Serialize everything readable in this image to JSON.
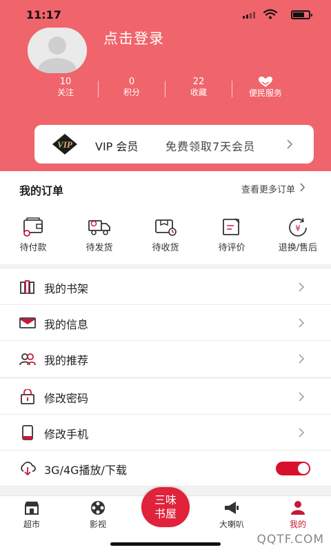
{
  "status_bar": {
    "time": "11:17"
  },
  "profile": {
    "login_label": "点击登录"
  },
  "stats": [
    {
      "value": "10",
      "label": "关注"
    },
    {
      "value": "0",
      "label": "积分"
    },
    {
      "value": "22",
      "label": "收藏"
    }
  ],
  "service": {
    "label": "便民服务"
  },
  "vip": {
    "logo_text": "VIP",
    "title": "VIP 会员",
    "promo": "免费领取7天会员"
  },
  "orders": {
    "title": "我的订单",
    "more_label": "查看更多订单",
    "items": [
      {
        "label": "待付款",
        "icon": "wallet-icon"
      },
      {
        "label": "待发货",
        "icon": "truck-icon"
      },
      {
        "label": "待收货",
        "icon": "package-clock-icon"
      },
      {
        "label": "待评价",
        "icon": "review-icon"
      },
      {
        "label": "退换/售后",
        "icon": "refund-icon"
      }
    ]
  },
  "menu_group1": [
    {
      "label": "我的书架",
      "icon": "bookshelf-icon"
    },
    {
      "label": "我的信息",
      "icon": "mail-icon"
    },
    {
      "label": "我的推荐",
      "icon": "users-icon"
    }
  ],
  "menu_group2": [
    {
      "label": "修改密码",
      "icon": "lock-icon"
    },
    {
      "label": "修改手机",
      "icon": "phone-icon"
    },
    {
      "label": "3G/4G播放/下载",
      "icon": "cloud-download-icon",
      "toggle_on": true
    }
  ],
  "tabbar": {
    "items": [
      {
        "label": "超市",
        "icon": "store-icon"
      },
      {
        "label": "影视",
        "icon": "film-reel-icon"
      },
      {
        "label": "大喇叭",
        "icon": "megaphone-icon"
      },
      {
        "label": "我的",
        "icon": "person-icon",
        "active": true
      }
    ],
    "center_label_line1": "三味",
    "center_label_line2": "书屋"
  },
  "watermark": "QQTF.COM",
  "colors": {
    "header_bg": "#f0646c",
    "accent_red": "#c8183a",
    "toggle_on": "#d9102c",
    "center_btn": "#e0223b"
  }
}
